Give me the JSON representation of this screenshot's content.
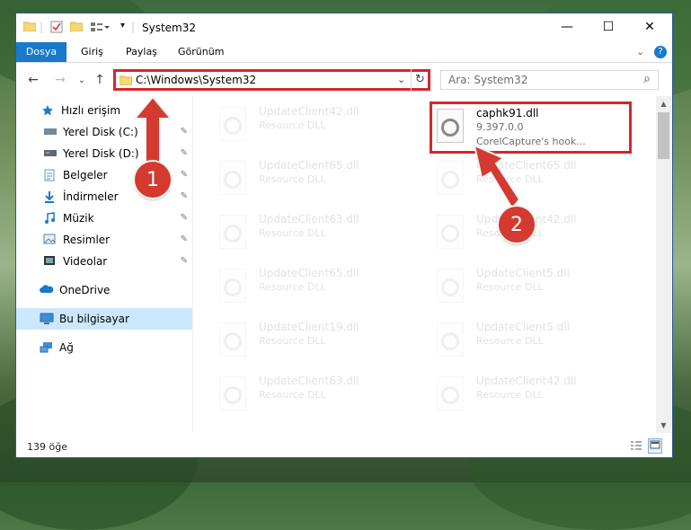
{
  "window": {
    "title": "System32",
    "controls": {
      "minimize": "—",
      "maximize": "☐",
      "close": "✕"
    }
  },
  "ribbon": {
    "tabs": [
      "Dosya",
      "Giriş",
      "Paylaş",
      "Görünüm"
    ],
    "help_icon": "?",
    "expand_icon": "⌄"
  },
  "address": {
    "path": "C:\\Windows\\System32",
    "back": "←",
    "forward": "→",
    "recent": "⌄",
    "up": "↑",
    "dropdown": "⌄",
    "refresh": "↻"
  },
  "search": {
    "placeholder": "Ara: System32",
    "icon": "⌕"
  },
  "nav": {
    "items": [
      {
        "label": "Hızlı erişim",
        "icon": "star-icon",
        "pinned": false
      },
      {
        "label": "Yerel Disk (C:)",
        "icon": "drive-icon",
        "pinned": true
      },
      {
        "label": "Yerel Disk (D:)",
        "icon": "drive-icon",
        "pinned": true
      },
      {
        "label": "Belgeler",
        "icon": "documents-icon",
        "pinned": true
      },
      {
        "label": "İndirmeler",
        "icon": "download-icon",
        "pinned": true
      },
      {
        "label": "Müzik",
        "icon": "music-icon",
        "pinned": true
      },
      {
        "label": "Resimler",
        "icon": "pictures-icon",
        "pinned": true
      },
      {
        "label": "Videolar",
        "icon": "videos-icon",
        "pinned": true
      },
      {
        "label": "OneDrive",
        "icon": "cloud-icon",
        "pinned": false
      },
      {
        "label": "Bu bilgisayar",
        "icon": "computer-icon",
        "pinned": false,
        "selected": true
      },
      {
        "label": "Ağ",
        "icon": "network-icon",
        "pinned": false
      }
    ],
    "pin_glyph": "📌"
  },
  "files": {
    "left_column": [
      {
        "name": "UpdateClient42.dll",
        "type": "Resource DLL"
      },
      {
        "name": "UpdateClient65.dll",
        "type": "Resource DLL"
      },
      {
        "name": "UpdateClient63.dll",
        "type": "Resource DLL"
      },
      {
        "name": "UpdateClient65.dll",
        "type": "Resource DLL"
      },
      {
        "name": "UpdateClient19.dll",
        "type": "Resource DLL"
      },
      {
        "name": "UpdateClient63.dll",
        "type": "Resource DLL"
      }
    ],
    "right_column": [
      {
        "name": "UpdateClient65.dll",
        "type": "Resource DLL"
      },
      {
        "name": "UpdateClient42.dll",
        "type": "Resource DLL"
      },
      {
        "name": "UpdateClient5.dll",
        "type": "Resource DLL"
      },
      {
        "name": "UpdateClient5.dll",
        "type": "Resource DLL"
      },
      {
        "name": "UpdateClient42.dll",
        "type": "Resource DLL"
      }
    ],
    "highlighted": {
      "name": "caphk91.dll",
      "version": "9.397.0.0",
      "description": "CorelCapture's hook..."
    }
  },
  "status": {
    "item_count": "139 öğe"
  },
  "annotations": {
    "step1": "1",
    "step2": "2",
    "highlight_color": "#d5262d"
  }
}
